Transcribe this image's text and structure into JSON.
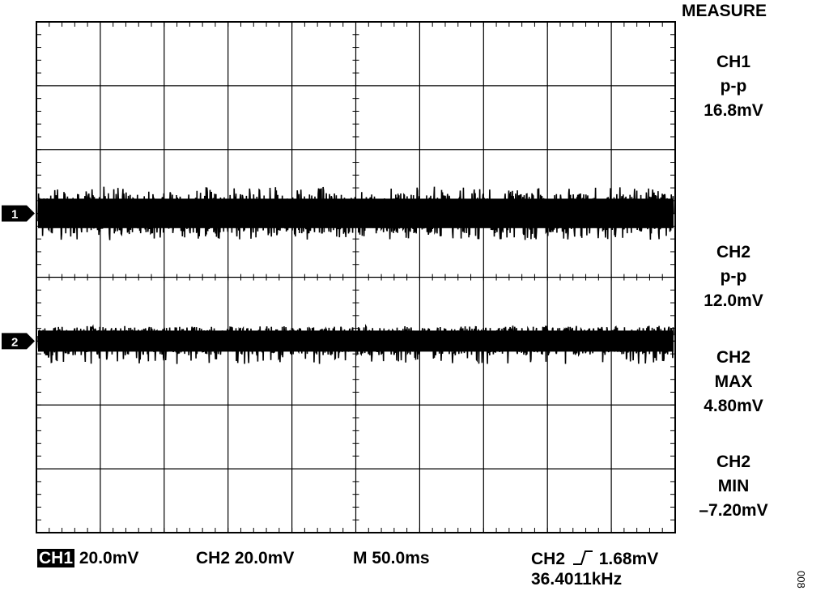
{
  "chart_data": {
    "type": "line",
    "title": "",
    "xlabel": "",
    "ylabel": "",
    "grid": true,
    "divisions": {
      "x": 10,
      "y": 8
    },
    "series": [
      {
        "name": "1",
        "marker_label": "1",
        "volts_per_div": "20.0mV",
        "offset_div": 1.0,
        "pp_mV": 16.8,
        "color": "#000000"
      },
      {
        "name": "2",
        "marker_label": "2",
        "volts_per_div": "20.0mV",
        "offset_div": -1.0,
        "pp_mV": 12.0,
        "max_mV": 4.8,
        "min_mV": -7.2,
        "color": "#000000"
      }
    ]
  },
  "measure": {
    "title": "MEASURE",
    "blocks": [
      {
        "lines": [
          "CH1",
          "p-p",
          "16.8mV"
        ]
      },
      {
        "lines": [
          "CH2",
          "p-p",
          "12.0mV"
        ]
      },
      {
        "lines": [
          "CH2",
          "MAX",
          "4.80mV"
        ]
      },
      {
        "lines": [
          "CH2",
          "MIN",
          "–7.20mV"
        ]
      }
    ]
  },
  "status": {
    "ch1_label": "CH1",
    "ch1_scale": "20.0mV",
    "ch2_scale": "CH2 20.0mV",
    "timebase": "M 50.0ms",
    "trigger_source": "CH2",
    "trigger_level": "1.68mV",
    "frequency": "36.4011kHz"
  },
  "figure_number": "008"
}
